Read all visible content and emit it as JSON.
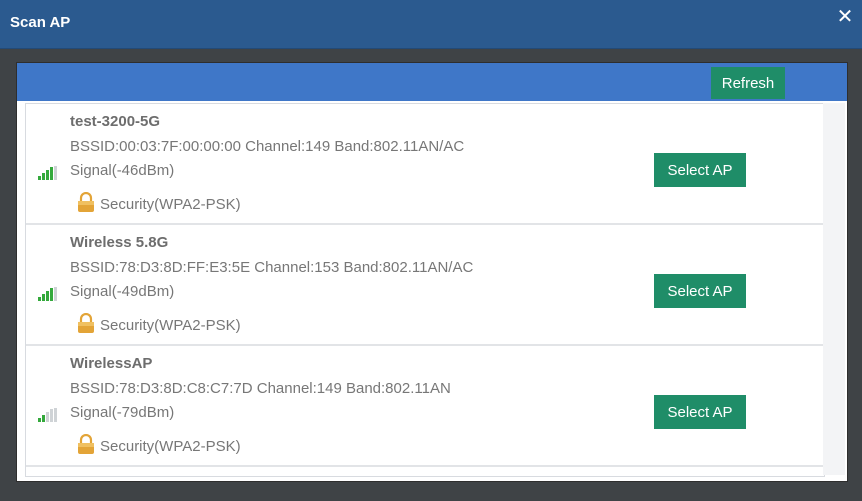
{
  "dialog": {
    "title": "Scan AP",
    "close_symbol": "✕",
    "refresh_label": "Refresh"
  },
  "access_points": [
    {
      "ssid": "test-3200-5G",
      "details": "BSSID:00:03:7F:00:00:00 Channel:149 Band:802.11AN/AC",
      "signal": "Signal(-46dBm)",
      "signal_bars": 4,
      "security": "Security(WPA2-PSK)",
      "button_label": "Select AP"
    },
    {
      "ssid": "Wireless 5.8G",
      "details": "BSSID:78:D3:8D:FF:E3:5E Channel:153 Band:802.11AN/AC",
      "signal": "Signal(-49dBm)",
      "signal_bars": 4,
      "security": "Security(WPA2-PSK)",
      "button_label": "Select AP"
    },
    {
      "ssid": "WirelessAP",
      "details": "BSSID:78:D3:8D:C8:C7:7D Channel:149 Band:802.11AN",
      "signal": "Signal(-79dBm)",
      "signal_bars": 2,
      "security": "Security(WPA2-PSK)",
      "button_label": "Select AP"
    }
  ],
  "colors": {
    "title_bar": "#2b5a8f",
    "panel_header": "#3f77c8",
    "button": "#1f8d68",
    "signal_active": "#34a93c",
    "signal_inactive": "#cfd3d6",
    "lock": "#e3a437"
  },
  "icons": {
    "close": "close-icon",
    "signal": "signal-strength-icon",
    "lock": "lock-icon"
  }
}
